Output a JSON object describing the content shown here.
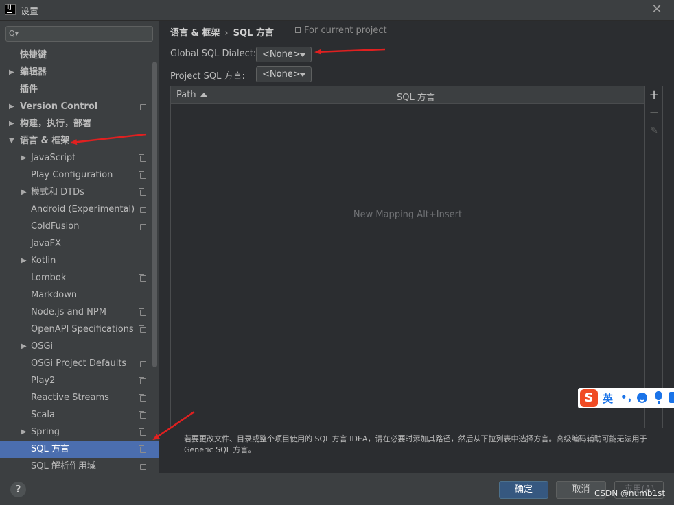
{
  "window": {
    "title": "设置",
    "app_icon_text": "IJ",
    "close_glyph": "✕"
  },
  "sidebar": {
    "search": {
      "placeholder": "",
      "value": "",
      "icon_glyph": "Q▾"
    },
    "items": [
      {
        "label": "快捷键",
        "bold": true,
        "arrow": "",
        "indent": 0,
        "copy": false
      },
      {
        "label": "编辑器",
        "bold": true,
        "arrow": "▶",
        "indent": 0,
        "copy": false
      },
      {
        "label": "插件",
        "bold": true,
        "arrow": "",
        "indent": 0,
        "copy": false
      },
      {
        "label": "Version Control",
        "bold": true,
        "arrow": "▶",
        "indent": 0,
        "copy": true
      },
      {
        "label": "构建，执行，部署",
        "bold": true,
        "arrow": "▶",
        "indent": 0,
        "copy": false
      },
      {
        "label": "语言 & 框架",
        "bold": true,
        "arrow": "▼",
        "indent": 0,
        "copy": false
      },
      {
        "label": "JavaScript",
        "bold": false,
        "arrow": "▶",
        "indent": 1,
        "copy": true
      },
      {
        "label": "Play Configuration",
        "bold": false,
        "arrow": "",
        "indent": 1,
        "copy": true
      },
      {
        "label": "模式和 DTDs",
        "bold": false,
        "arrow": "▶",
        "indent": 1,
        "copy": true
      },
      {
        "label": "Android (Experimental)",
        "bold": false,
        "arrow": "",
        "indent": 1,
        "copy": true
      },
      {
        "label": "ColdFusion",
        "bold": false,
        "arrow": "",
        "indent": 1,
        "copy": true
      },
      {
        "label": "JavaFX",
        "bold": false,
        "arrow": "",
        "indent": 1,
        "copy": false
      },
      {
        "label": "Kotlin",
        "bold": false,
        "arrow": "▶",
        "indent": 1,
        "copy": false
      },
      {
        "label": "Lombok",
        "bold": false,
        "arrow": "",
        "indent": 1,
        "copy": true
      },
      {
        "label": "Markdown",
        "bold": false,
        "arrow": "",
        "indent": 1,
        "copy": false
      },
      {
        "label": "Node.js and NPM",
        "bold": false,
        "arrow": "",
        "indent": 1,
        "copy": true
      },
      {
        "label": "OpenAPI Specifications",
        "bold": false,
        "arrow": "",
        "indent": 1,
        "copy": true
      },
      {
        "label": "OSGi",
        "bold": false,
        "arrow": "▶",
        "indent": 1,
        "copy": false
      },
      {
        "label": "OSGi Project Defaults",
        "bold": false,
        "arrow": "",
        "indent": 1,
        "copy": true
      },
      {
        "label": "Play2",
        "bold": false,
        "arrow": "",
        "indent": 1,
        "copy": true
      },
      {
        "label": "Reactive Streams",
        "bold": false,
        "arrow": "",
        "indent": 1,
        "copy": true
      },
      {
        "label": "Scala",
        "bold": false,
        "arrow": "",
        "indent": 1,
        "copy": true
      },
      {
        "label": "Spring",
        "bold": false,
        "arrow": "▶",
        "indent": 1,
        "copy": true
      },
      {
        "label": "SQL 方言",
        "bold": false,
        "arrow": "",
        "indent": 1,
        "copy": true,
        "selected": true
      },
      {
        "label": "SQL 解析作用域",
        "bold": false,
        "arrow": "",
        "indent": 1,
        "copy": true
      }
    ]
  },
  "main": {
    "breadcrumb": {
      "parent": "语言 & 框架",
      "separator": "›",
      "current": "SQL 方言"
    },
    "for_project": "For current project",
    "global_dialect": {
      "label": "Global SQL Dialect:",
      "value": "<None>"
    },
    "project_dialect": {
      "label": "Project SQL 方言:",
      "value": "<None>"
    },
    "table": {
      "columns": [
        "Path",
        "SQL 方言"
      ],
      "empty_text": "New Mapping Alt+Insert"
    },
    "toolbar": {
      "add": "+",
      "remove": "−",
      "edit": "✎"
    },
    "description": "若要更改文件、目录或整个项目使用的 SQL 方言 IDEA，请在必要时添加其路径，然后从下拉列表中选择方言。高级编码辅助可能无法用于 Generic SQL 方言。"
  },
  "ime": {
    "logo": "S",
    "lang": "英",
    "punct": "•，"
  },
  "footer": {
    "help": "?",
    "ok": "确定",
    "cancel": "取消",
    "apply": "应用(A)",
    "watermark": "CSDN @numb1st"
  },
  "colors": {
    "accent": "#4b6eaf",
    "ok_button": "#365880",
    "annotation": "#e02020"
  }
}
